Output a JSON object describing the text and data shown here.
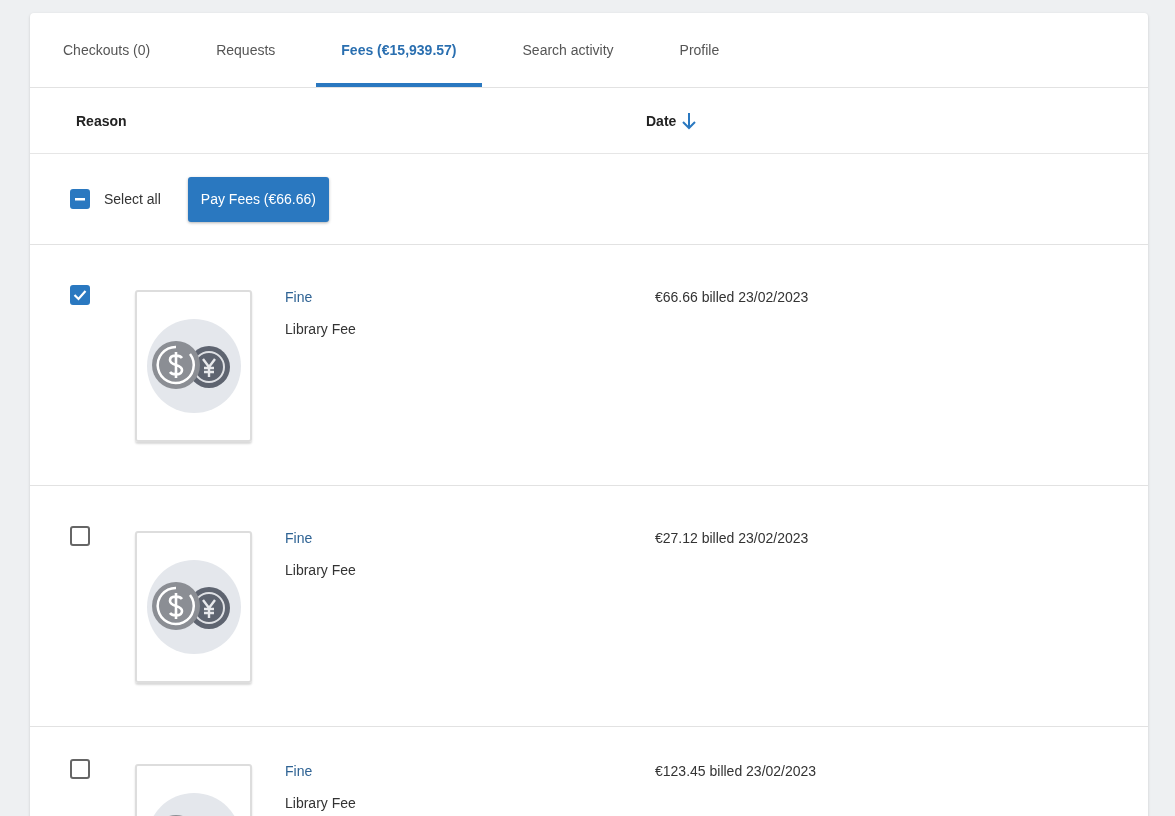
{
  "tabs": [
    {
      "label": "Checkouts (0)",
      "selected": false
    },
    {
      "label": "Requests",
      "selected": false
    },
    {
      "label": "Fees (€15,939.57)",
      "selected": true
    },
    {
      "label": "Search activity",
      "selected": false
    },
    {
      "label": "Profile",
      "selected": false
    }
  ],
  "table": {
    "columns": [
      {
        "label": "Reason",
        "sorted": false
      },
      {
        "label": "Date",
        "sorted": true
      }
    ],
    "select_all": {
      "label": "Select all",
      "indeterminate": true
    },
    "pay_button": "Pay Fees (€66.66)",
    "rows": [
      {
        "checked": true,
        "type": "Fine",
        "description": "Library Fee",
        "billed": "€66.66 billed 23/02/2023"
      },
      {
        "checked": false,
        "type": "Fine",
        "description": "Library Fee",
        "billed": "€27.12 billed 23/02/2023"
      },
      {
        "checked": false,
        "type": "Fine",
        "description": "Library Fee",
        "billed": "€123.45 billed 23/02/2023"
      }
    ]
  }
}
